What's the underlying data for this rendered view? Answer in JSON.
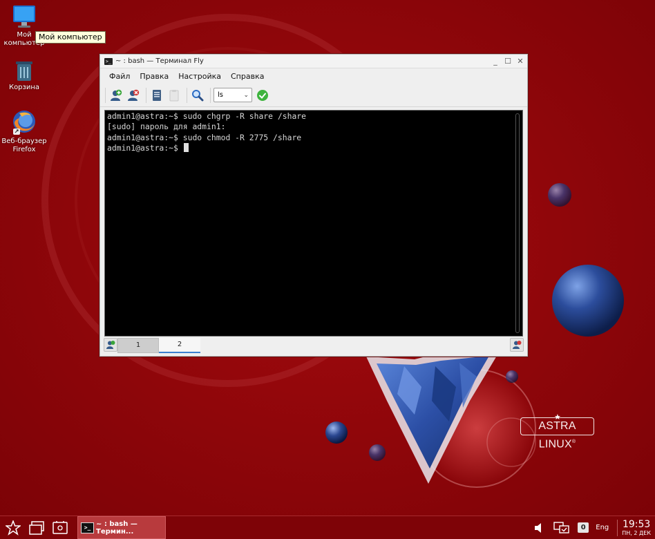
{
  "desktop": {
    "tooltip": "Мой компьютер",
    "icons": [
      {
        "label": "Мой\nкомпьютер",
        "icon": "monitor-icon"
      },
      {
        "label": "Корзина",
        "icon": "trash-icon"
      },
      {
        "label": "Веб-браузер\nFirefox",
        "icon": "firefox-icon"
      }
    ],
    "logo_text": "ASTRA LINUX",
    "logo_mark": "®"
  },
  "window": {
    "title": "~ : bash — Терминал Fly",
    "controls": {
      "minimize": "_",
      "maximize": "☐",
      "close": "✕"
    },
    "menu": [
      "Файл",
      "Правка",
      "Настройка",
      "Справка"
    ],
    "toolbar": {
      "command_value": "ls",
      "icons": [
        "new-session-icon",
        "close-session-icon",
        "copy-icon",
        "paste-icon",
        "find-icon",
        "run-icon"
      ]
    },
    "terminal_lines": [
      "admin1@astra:~$ sudo chgrp -R share /share",
      "[sudo] пароль для admin1:",
      "admin1@astra:~$ sudo chmod -R 2775 /share",
      "admin1@astra:~$ "
    ],
    "tabs": [
      {
        "label": "1",
        "active": false
      },
      {
        "label": "2",
        "active": true
      }
    ]
  },
  "taskbar": {
    "task_label": "~ : bash — Термин...",
    "task_icon_text": ">_",
    "tray": {
      "notification_count": "0",
      "language": "Eng",
      "time": "19:53",
      "date": "ПН, 2 ДЕК"
    }
  },
  "colors": {
    "desktop_bg": "#8c0408",
    "taskbar_bg": "#7e0307",
    "terminal_bg": "#000000",
    "terminal_fg": "#d7d7d7",
    "active_tab_accent": "#3a7fd0"
  }
}
